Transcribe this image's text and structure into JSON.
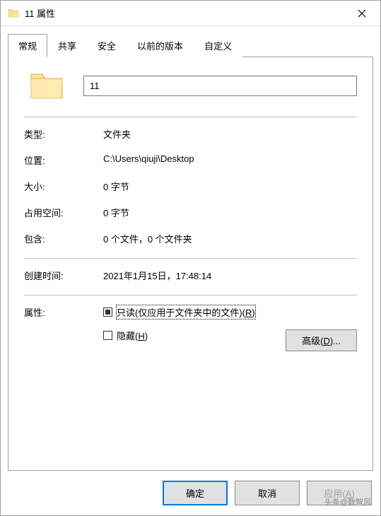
{
  "titlebar": {
    "title": "11 属性"
  },
  "tabs": {
    "items": [
      {
        "label": "常规"
      },
      {
        "label": "共享"
      },
      {
        "label": "安全"
      },
      {
        "label": "以前的版本"
      },
      {
        "label": "自定义"
      }
    ]
  },
  "general": {
    "name_value": "11",
    "type_label": "类型:",
    "type_value": "文件夹",
    "location_label": "位置:",
    "location_value": "C:\\Users\\qiuji\\Desktop",
    "size_label": "大小:",
    "size_value": "0 字节",
    "size_on_disk_label": "占用空间:",
    "size_on_disk_value": "0 字节",
    "contains_label": "包含:",
    "contains_value": "0 个文件，0 个文件夹",
    "created_label": "创建时间:",
    "created_value": "2021年1月15日，17:48:14",
    "attributes_label": "属性:",
    "readonly_text": "只读(仅应用于文件夹中的文件)(",
    "readonly_key": "R",
    "readonly_suffix": ")",
    "hidden_text": "隐藏(",
    "hidden_key": "H",
    "hidden_suffix": ")",
    "advanced_text": "高级(",
    "advanced_key": "D",
    "advanced_suffix": ")..."
  },
  "buttons": {
    "ok": "确定",
    "cancel": "取消",
    "apply_text": "应用(",
    "apply_key": "A",
    "apply_suffix": ")"
  },
  "watermark": "头条@数智风"
}
